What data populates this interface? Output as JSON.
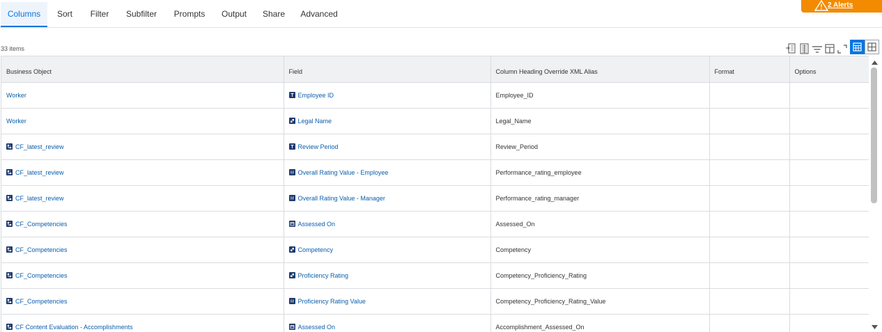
{
  "tabs": [
    {
      "label": "Columns",
      "active": true
    },
    {
      "label": "Sort"
    },
    {
      "label": "Filter"
    },
    {
      "label": "Subfilter"
    },
    {
      "label": "Prompts"
    },
    {
      "label": "Output"
    },
    {
      "label": "Share"
    },
    {
      "label": "Advanced"
    }
  ],
  "alerts": {
    "label": "2 Alerts",
    "color": "#f38b00",
    "icon": "warning-triangle-icon"
  },
  "grid": {
    "count_label": "33 items",
    "columns": [
      "Business Object",
      "Field",
      "Column Heading Override XML Alias",
      "Format",
      "Options"
    ],
    "rows": [
      {
        "bo": "Worker",
        "bo_icon": null,
        "field": "Employee ID",
        "field_icon": "text-field-icon",
        "alias": "Employee_ID"
      },
      {
        "bo": "Worker",
        "bo_icon": null,
        "field": "Legal Name",
        "field_icon": "instance-field-icon",
        "alias": "Legal_Name"
      },
      {
        "bo": "CF_latest_review",
        "bo_icon": "related-object-icon",
        "field": "Review Period",
        "field_icon": "text-field-icon",
        "alias": "Review_Period"
      },
      {
        "bo": "CF_latest_review",
        "bo_icon": "related-object-icon",
        "field": "Overall Rating Value - Employee",
        "field_icon": "numeric-field-icon",
        "alias": "Performance_rating_employee"
      },
      {
        "bo": "CF_latest_review",
        "bo_icon": "related-object-icon",
        "field": "Overall Rating Value - Manager",
        "field_icon": "numeric-field-icon",
        "alias": "Performance_rating_manager"
      },
      {
        "bo": "CF_Competencies",
        "bo_icon": "related-object-icon",
        "field": "Assessed On",
        "field_icon": "date-field-icon",
        "alias": "Assessed_On"
      },
      {
        "bo": "CF_Competencies",
        "bo_icon": "related-object-icon",
        "field": "Competency",
        "field_icon": "instance-field-icon",
        "alias": "Competency"
      },
      {
        "bo": "CF_Competencies",
        "bo_icon": "related-object-icon",
        "field": "Proficiency Rating",
        "field_icon": "instance-field-icon",
        "alias": "Competency_Proficiency_Rating"
      },
      {
        "bo": "CF_Competencies",
        "bo_icon": "related-object-icon",
        "field": "Proficiency Rating Value",
        "field_icon": "numeric-field-icon",
        "alias": "Competency_Proficiency_Rating_Value"
      },
      {
        "bo": "CF Content Evaluation - Accomplishments",
        "bo_icon": "related-object-icon",
        "field": "Assessed On",
        "field_icon": "date-field-icon",
        "alias": "Accomplishment_Assessed_On"
      }
    ]
  },
  "toolbar": {
    "icons": [
      "export-excel-icon",
      "export-pdf-icon",
      "filter-icon",
      "column-chooser-icon",
      "fullscreen-icon"
    ],
    "views": [
      {
        "icon": "table-view-icon",
        "active": true
      },
      {
        "icon": "grid-view-icon",
        "active": false
      }
    ]
  },
  "colors": {
    "accent": "#0875e1",
    "link": "#0b5fad",
    "icon_navy": "#1f3b6e"
  }
}
